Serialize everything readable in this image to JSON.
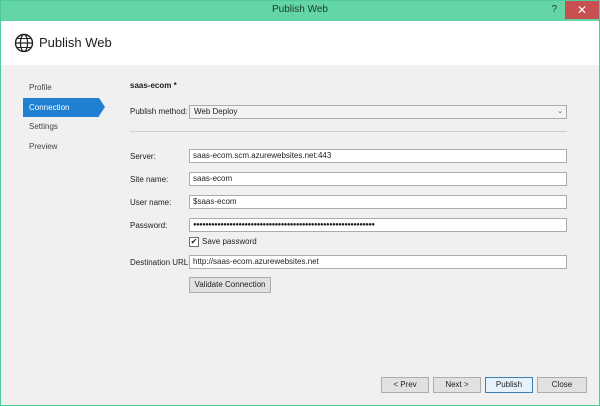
{
  "window": {
    "title": "Publish Web",
    "help_glyph": "?",
    "close_glyph": "✕"
  },
  "header": {
    "title": "Publish Web",
    "icon": "globe-icon"
  },
  "sidebar": {
    "items": [
      {
        "label": "Profile",
        "active": false
      },
      {
        "label": "Connection",
        "active": true
      },
      {
        "label": "Settings",
        "active": false
      },
      {
        "label": "Preview",
        "active": false
      }
    ]
  },
  "main": {
    "profile_name": "saas-ecom *",
    "publish_method": {
      "label": "Publish method:",
      "value": "Web Deploy"
    },
    "server": {
      "label": "Server:",
      "value": "saas-ecom.scm.azurewebsites.net:443"
    },
    "site_name": {
      "label": "Site name:",
      "value": "saas-ecom"
    },
    "user_name": {
      "label": "User name:",
      "value": "$saas-ecom"
    },
    "password": {
      "label": "Password:",
      "value": "●●●●●●●●●●●●●●●●●●●●●●●●●●●●●●●●●●●●●●●●●●●●●●●●●●●●●●●●●●●●"
    },
    "save_password": {
      "label": "Save password",
      "checked": true,
      "check_glyph": "✔"
    },
    "destination_url": {
      "label": "Destination URL:",
      "value": "http://saas-ecom.azurewebsites.net"
    },
    "validate_button": "Validate Connection"
  },
  "footer": {
    "prev": "< Prev",
    "next": "Next >",
    "publish": "Publish",
    "close": "Close"
  },
  "colors": {
    "titlebar": "#64d5a5",
    "accent": "#1e7fd3",
    "close_button": "#c75050"
  }
}
